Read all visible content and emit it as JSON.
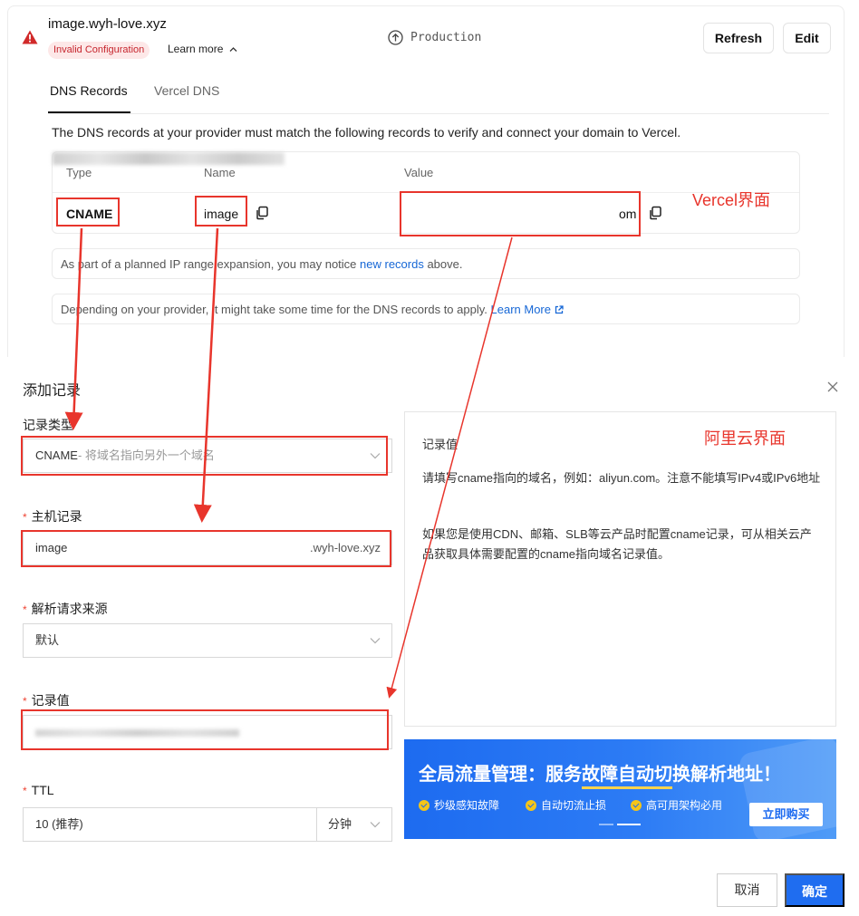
{
  "vercel": {
    "domain": "image.wyh-love.xyz",
    "badge": "Invalid Configuration",
    "learn_more": "Learn more",
    "environment": "Production",
    "refresh_label": "Refresh",
    "edit_label": "Edit",
    "tabs": [
      "DNS Records",
      "Vercel DNS"
    ],
    "description": "The DNS records at your provider must match the following records to verify and connect your domain to Vercel.",
    "table": {
      "headers": [
        "Type",
        "Name",
        "Value"
      ],
      "row": {
        "type": "CNAME",
        "name": "image",
        "value_tail": "om"
      }
    },
    "note1": {
      "before": "As part of a planned IP range expansion, you may notice ",
      "link": "new records",
      "after": " above."
    },
    "note2": {
      "before": "Depending on your provider, it might take some time for the DNS records to apply. ",
      "link": "Learn More"
    }
  },
  "aliyun": {
    "dialog_title": "添加记录",
    "record_type_label": "记录类型",
    "record_type_value": "CNAME",
    "record_type_hint": "- 将域名指向另外一个域名",
    "host_label": "主机记录",
    "host_value": "image",
    "host_suffix": ".wyh-love.xyz",
    "source_label": "解析请求来源",
    "source_value": "默认",
    "record_value_label": "记录值",
    "ttl_label": "TTL",
    "ttl_value": "10 (推荐)",
    "ttl_unit": "分钟",
    "info": {
      "title": "记录值",
      "text1": "请填写cname指向的域名，例如：aliyun.com。注意不能填写IPv4或IPv6地址",
      "text2": "如果您是使用CDN、邮箱、SLB等云产品时配置cname记录，可从相关云产品获取具体需要配置的cname指向域名记录值。"
    },
    "banner": {
      "title": "全局流量管理：服务故障自动切换解析地址！",
      "features": [
        "秒级感知故障",
        "自动切流止损",
        "高可用架构必用"
      ],
      "buy_label": "立即购买"
    },
    "cancel_label": "取消",
    "ok_label": "确定"
  },
  "annotations": {
    "vercel_label": "Vercel界面",
    "aliyun_label": "阿里云界面",
    "color": "#e8352c"
  },
  "colors": {
    "accent_blue": "#1f6df0",
    "danger": "#c6262e",
    "link": "#1667d6"
  }
}
